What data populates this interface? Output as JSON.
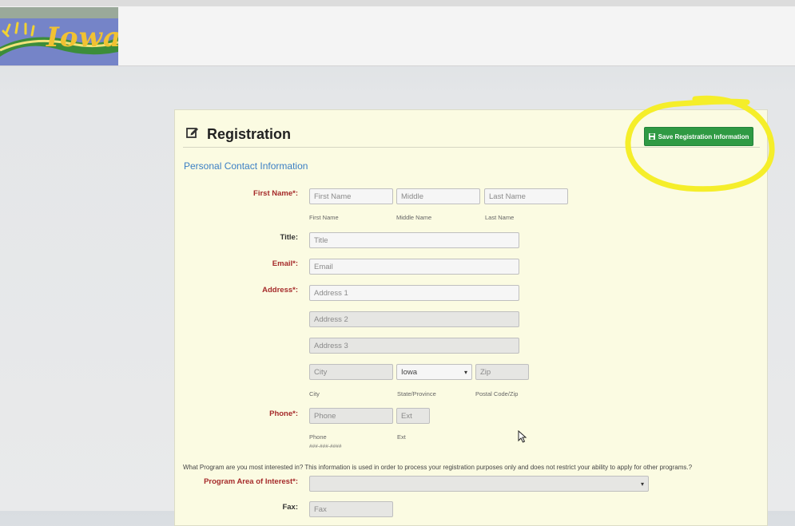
{
  "header": {
    "logo_text": "Iowa",
    "logo_icon": "sun-rays-icon"
  },
  "registration": {
    "title": "Registration",
    "title_icon": "edit-icon",
    "save_button": {
      "label": "Save Registration Information",
      "icon": "floppy-disk-icon",
      "color": "#2f9a43"
    },
    "section_heading": "Personal Contact Information",
    "fields": {
      "first_name": {
        "label": "First Name*:",
        "first": {
          "placeholder": "First Name",
          "hint": "First Name"
        },
        "middle": {
          "placeholder": "Middle",
          "hint": "Middle Name"
        },
        "last": {
          "placeholder": "Last Name",
          "hint": "Last Name"
        }
      },
      "title": {
        "label": "Title:",
        "placeholder": "Title"
      },
      "email": {
        "label": "Email*:",
        "placeholder": "Email"
      },
      "address": {
        "label": "Address*:",
        "line1": {
          "placeholder": "Address 1"
        },
        "line2": {
          "placeholder": "Address 2"
        },
        "line3": {
          "placeholder": "Address 3"
        },
        "city": {
          "placeholder": "City",
          "hint": "City"
        },
        "state": {
          "value": "Iowa",
          "hint": "State/Province"
        },
        "zip": {
          "placeholder": "Zip",
          "hint": "Postal Code/Zip"
        }
      },
      "phone": {
        "label": "Phone*:",
        "number": {
          "placeholder": "Phone",
          "hint": "Phone",
          "format_hint": "###-###-####"
        },
        "ext": {
          "placeholder": "Ext",
          "hint": "Ext"
        }
      },
      "program_question": "What Program are you most interested in? This information is used in order to process your registration purposes only and does not restrict your ability to apply for other programs.?",
      "program_area": {
        "label": "Program Area of Interest*:",
        "value": ""
      },
      "fax": {
        "label": "Fax:",
        "placeholder": "Fax"
      }
    }
  },
  "annotation": {
    "highlight_color": "#f5ee2a"
  }
}
